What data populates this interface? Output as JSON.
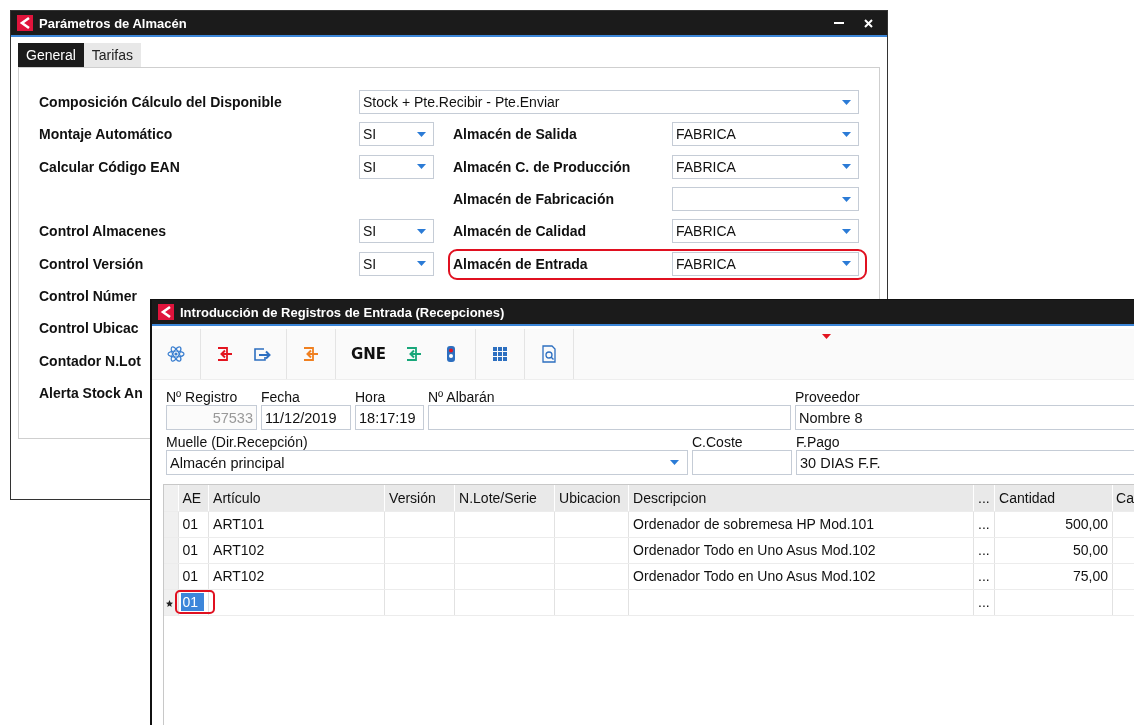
{
  "params_window": {
    "title": "Parámetros de Almacén",
    "tabs": [
      {
        "label": "General",
        "selected": true
      },
      {
        "label": "Tarifas",
        "selected": false
      }
    ],
    "rows": [
      {
        "kind": "wide",
        "label": "Composición Cálculo del Disponible",
        "value": "Stock + Pte.Recibir - Pte.Enviar"
      },
      {
        "kind": "pair",
        "label": "Montaje Automático",
        "value": "SI",
        "right_label": "Almacén de Salida",
        "right_value": "FABRICA"
      },
      {
        "kind": "pair",
        "label": "Calcular Código EAN",
        "value": "SI",
        "right_label": "Almacén C. de Producción",
        "right_value": "FABRICA"
      },
      {
        "kind": "pair",
        "right_label": "Almacén de Fabricación"
      },
      {
        "kind": "pair",
        "label": "Control Almacenes",
        "value": "SI",
        "right_label": "Almacén de Calidad",
        "right_value": "FABRICA"
      },
      {
        "kind": "pair",
        "label": "Control Versión",
        "value": "SI",
        "right_label": "Almacén de Entrada",
        "right_value": "FABRICA",
        "highlighted": true
      },
      {
        "kind": "label",
        "label": "Control Númer"
      },
      {
        "kind": "label",
        "label": "Control Ubicac"
      },
      {
        "kind": "label",
        "label": "Contador N.Lot"
      },
      {
        "kind": "label",
        "label": "Alerta Stock An"
      }
    ]
  },
  "receipt_window": {
    "title": "Introducción de Registros de Entrada (Recepciones)",
    "toolbar_text": "GNE",
    "header_fields": [
      {
        "label": "Nº Registro",
        "value": "57533",
        "kind": "text",
        "disabled": true
      },
      {
        "label": "Fecha",
        "value": "11/12/2019",
        "kind": "text"
      },
      {
        "label": "Hora",
        "value": "18:17:19",
        "kind": "text"
      },
      {
        "label": "Nº Albarán",
        "kind": "text"
      },
      {
        "label": "Proveedor",
        "value": "Nombre 8",
        "kind": "text"
      },
      {
        "label": "Muelle (Dir.Recepción)",
        "value": "Almacén principal",
        "kind": "select"
      },
      {
        "label": "C.Coste",
        "kind": "text"
      },
      {
        "label": "F.Pago",
        "value": "30 DIAS F.F.",
        "kind": "text"
      }
    ],
    "grid": {
      "columns": [
        "AE",
        "Artículo",
        "Versión",
        "N.Lote/Serie",
        "Ubicacion",
        "Descripcion",
        "...",
        "Cantidad",
        "Ca"
      ],
      "rows": [
        {
          "ae": "01",
          "articulo": "ART101",
          "descripcion": "Ordenador de sobremesa HP Mod.101",
          "more": "...",
          "cantidad": "500,00"
        },
        {
          "ae": "01",
          "articulo": "ART102",
          "descripcion": "Ordenador Todo en Uno Asus Mod.102",
          "more": "...",
          "cantidad": "50,00"
        },
        {
          "ae": "01",
          "articulo": "ART102",
          "descripcion": "Ordenador Todo en Uno Asus Mod.102",
          "more": "...",
          "cantidad": "75,00"
        },
        {
          "ae": "01",
          "more": "...",
          "current": true,
          "highlighted": true
        }
      ]
    }
  }
}
